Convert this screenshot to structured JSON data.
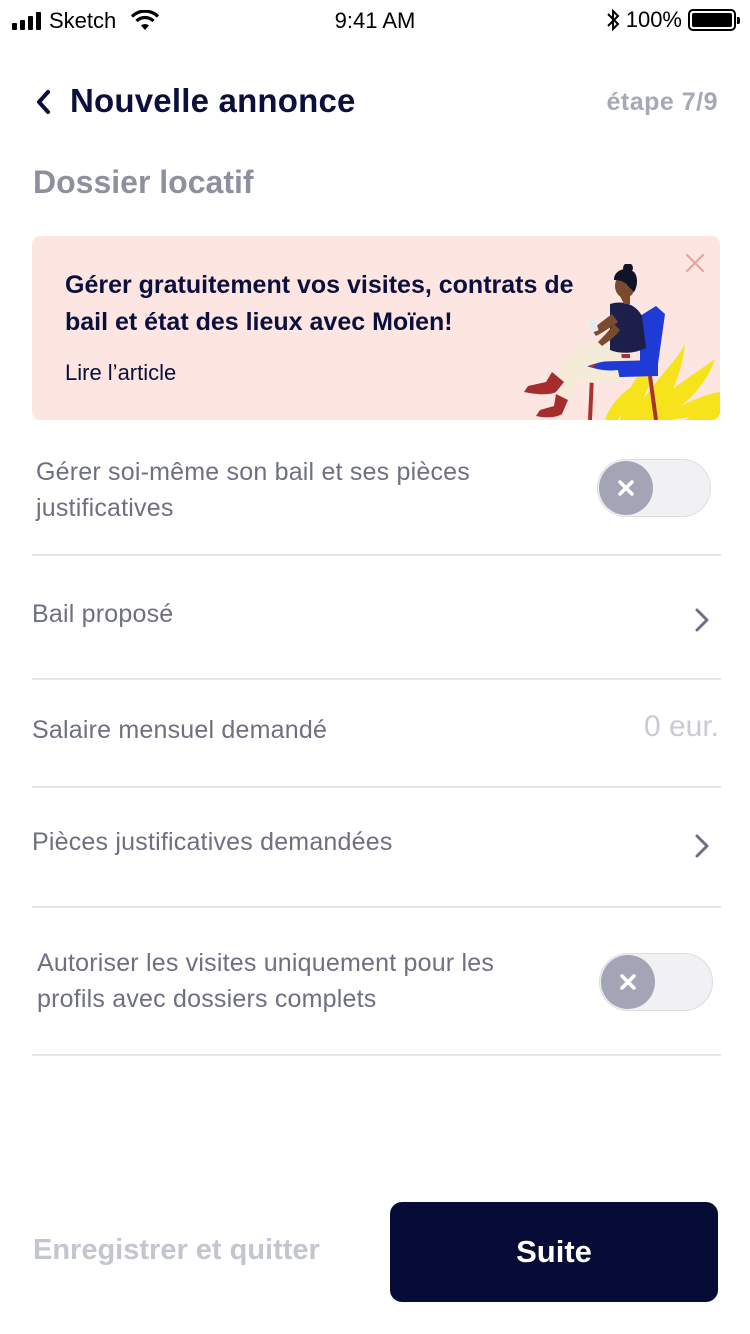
{
  "status_bar": {
    "carrier": "Sketch",
    "time": "9:41 AM",
    "battery": "100%",
    "battery_level": 1.0,
    "icons": [
      "signal-icon",
      "wifi-icon",
      "bluetooth-icon",
      "battery-icon"
    ]
  },
  "header": {
    "title": "Nouvelle annonce",
    "step": "étape 7/9",
    "back_icon": "chevron-left-icon"
  },
  "section": {
    "title": "Dossier locatif"
  },
  "promo": {
    "text": "Gérer gratuitement vos visites, contrats de bail et état des lieux avec Moïen!",
    "link": "Lire l’article",
    "close_icon": "close-icon",
    "illustration": "woman-on-chair-illustration",
    "background_color": "#fde6e2"
  },
  "rows": [
    {
      "label": "Gérer soi-même son bail et ses pièces justificatives",
      "control": "toggle",
      "toggle_on": false
    },
    {
      "label": "Bail proposé",
      "control": "chevron"
    },
    {
      "label": "Salaire mensuel demandé",
      "control": "value",
      "value": "0 eur."
    },
    {
      "label": "Pièces justificatives demandées",
      "control": "chevron"
    },
    {
      "label": "Autoriser les visites uniquement pour les profils avec dossiers complets",
      "control": "toggle",
      "toggle_on": false
    }
  ],
  "footer": {
    "save_quit": "Enregistrer et quitter",
    "next": "Suite"
  },
  "colors": {
    "primary": "#060c35",
    "text_dark": "#0a0f3c",
    "text_muted": "#6e7082",
    "accent_blue": "#1f3bd6",
    "accent_yellow": "#f7e31c"
  }
}
